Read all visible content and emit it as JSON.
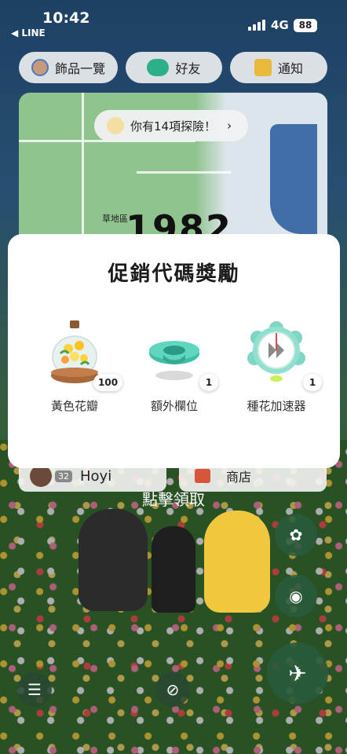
{
  "status_bar": {
    "time": "10:42",
    "back_app": "◀ LINE",
    "network": "4G",
    "battery": "88"
  },
  "top_buttons": {
    "accessories": "飾品一覽",
    "friends": "好友",
    "notifications": "通知"
  },
  "map": {
    "adventure_prompt": "你有14項探險！",
    "place_label": "草地區",
    "step_count": "1982"
  },
  "profile": {
    "level": "32",
    "name": "Hoyi"
  },
  "shop": {
    "label": "商店"
  },
  "modal": {
    "title": "促銷代碼獎勵",
    "rewards": [
      {
        "name": "黃色花瓣",
        "count": "100",
        "icon": "yellow-petals-vase"
      },
      {
        "name": "額外欄位",
        "count": "1",
        "icon": "extra-slot-pot"
      },
      {
        "name": "種花加速器",
        "count": "1",
        "icon": "flower-accelerator-clock"
      }
    ]
  },
  "claim_text": "點擊領取",
  "colors": {
    "accent_teal": "#3fbfa6",
    "modal_bg": "#ffffff"
  }
}
